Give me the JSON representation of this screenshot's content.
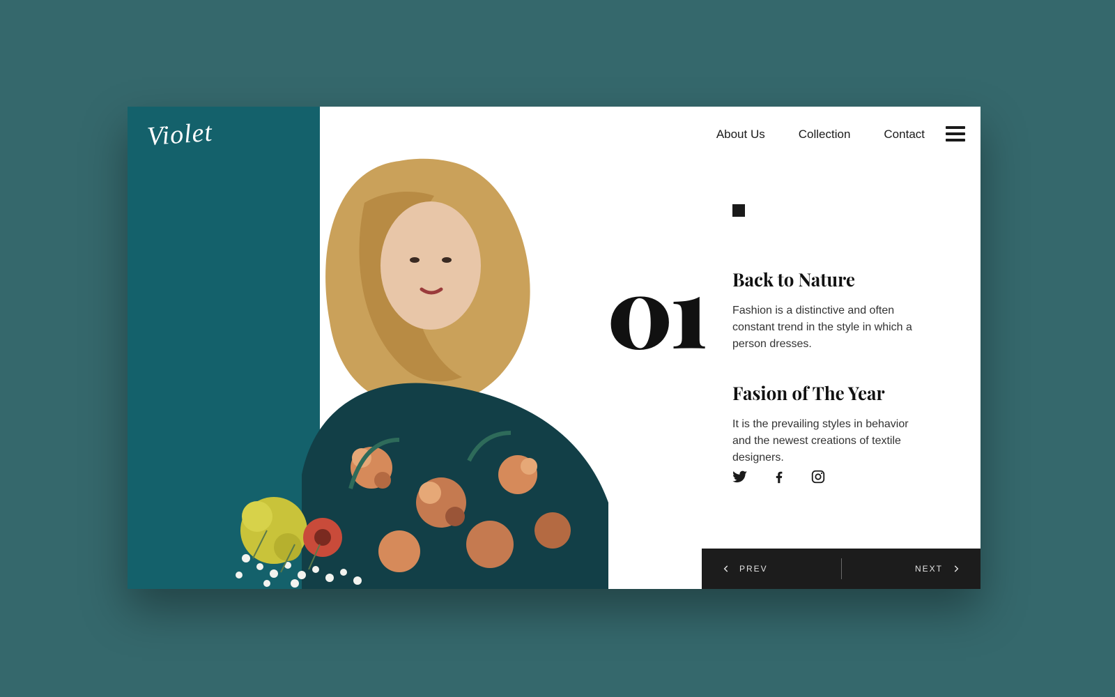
{
  "brand": {
    "logo_text": "Violet"
  },
  "nav": {
    "items": [
      "About Us",
      "Collection",
      "Contact"
    ]
  },
  "hero": {
    "slide_number": "01",
    "sections": [
      {
        "heading": "Back to Nature",
        "body": "Fashion is a distinctive and often constant trend in the style in which a person dresses."
      },
      {
        "heading": "Fasion of The Year",
        "body": "It is the prevailing styles in behavior and the newest creations of textile designers."
      }
    ]
  },
  "social": {
    "twitter": "twitter-icon",
    "facebook": "facebook-icon",
    "instagram": "instagram-icon"
  },
  "pager": {
    "prev_label": "PREV",
    "next_label": "NEXT"
  },
  "colors": {
    "page_bg": "#35686c",
    "band": "#14616b",
    "footer": "#1c1c1c"
  }
}
